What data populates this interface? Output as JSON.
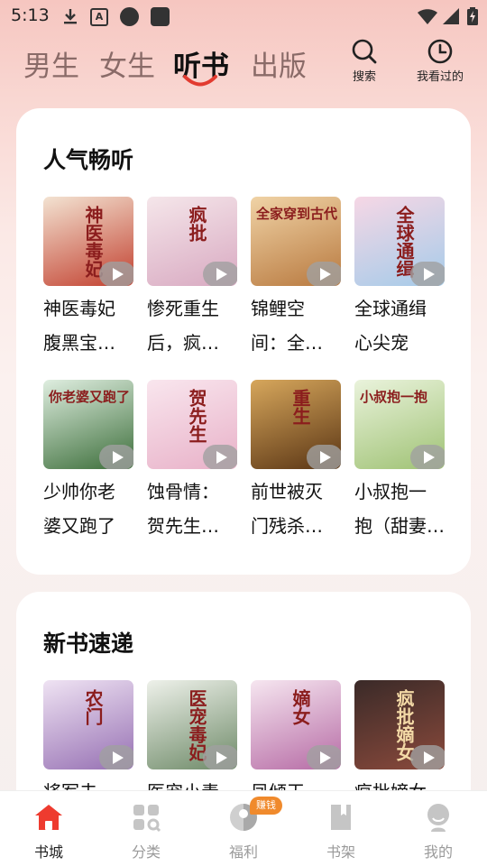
{
  "status_bar": {
    "time": "5:13",
    "icons": [
      "download-icon",
      "app-notification-icon",
      "circle-notification-icon",
      "square-notification-icon",
      "wifi-icon",
      "signal-icon",
      "battery-charging-icon"
    ]
  },
  "top_tabs": [
    {
      "label": "男生",
      "active": false
    },
    {
      "label": "女生",
      "active": false
    },
    {
      "label": "听书",
      "active": true
    },
    {
      "label": "出版",
      "active": false
    }
  ],
  "top_actions": {
    "search_label": "搜索",
    "history_label": "我看过的"
  },
  "sections": {
    "popular": {
      "title": "人气畅听",
      "books": [
        {
          "name_line1": "神医毒妃",
          "name_line2": "腹黑宝…",
          "cover_text": "神医毒妃",
          "cover_colors": [
            "#f3e3d2",
            "#c2402f"
          ]
        },
        {
          "name_line1": "惨死重生",
          "name_line2": "后，疯…",
          "cover_text": "疯批",
          "cover_colors": [
            "#f5e6ea",
            "#d8a9c1"
          ]
        },
        {
          "name_line1": "锦鲤空",
          "name_line2": "间：全…",
          "cover_text": "全家穿到古代",
          "cover_colors": [
            "#f0d3a6",
            "#b8793f"
          ]
        },
        {
          "name_line1": "全球通缉",
          "name_line2": "心尖宠",
          "cover_text": "全球通缉",
          "cover_colors": [
            "#f6d7e5",
            "#a5cbe9"
          ]
        },
        {
          "name_line1": "少帅你老",
          "name_line2": "婆又跑了",
          "cover_text": "你老婆又跑了",
          "cover_colors": [
            "#dfeee0",
            "#3c6e3a"
          ]
        },
        {
          "name_line1": "蚀骨情：",
          "name_line2": "贺先生…",
          "cover_text": "贺先生",
          "cover_colors": [
            "#f9e6ee",
            "#e8b1c8"
          ]
        },
        {
          "name_line1": "前世被灭",
          "name_line2": "门残杀…",
          "cover_text": "重生",
          "cover_colors": [
            "#d7a75c",
            "#5a3514"
          ]
        },
        {
          "name_line1": "小叔抱一",
          "name_line2": "抱（甜妻…",
          "cover_text": "小叔抱一抱",
          "cover_colors": [
            "#eaf3dc",
            "#9fc274"
          ]
        }
      ]
    },
    "new_books": {
      "title": "新书速递",
      "books": [
        {
          "name_line1": "将军夫",
          "cover_text": "农门",
          "cover_colors": [
            "#efe3f3",
            "#9670b3"
          ]
        },
        {
          "name_line1": "医宠小毒",
          "cover_text": "医宠毒妃",
          "cover_colors": [
            "#eef1ea",
            "#6e8a68"
          ]
        },
        {
          "name_line1": "凤倾天",
          "cover_text": "嫡女",
          "cover_colors": [
            "#f6e6f0",
            "#b66ba5"
          ]
        },
        {
          "name_line1": "疯批嫡女",
          "cover_text": "疯批嫡女",
          "cover_colors": [
            "#3a2a28",
            "#8b4a3c"
          ]
        }
      ]
    }
  },
  "bottom_nav": {
    "items": [
      {
        "label": "书城",
        "active": true
      },
      {
        "label": "分类",
        "active": false
      },
      {
        "label": "福利",
        "active": false
      },
      {
        "label": "书架",
        "active": false
      },
      {
        "label": "我的",
        "active": false
      }
    ],
    "earn_badge": "赚钱"
  }
}
